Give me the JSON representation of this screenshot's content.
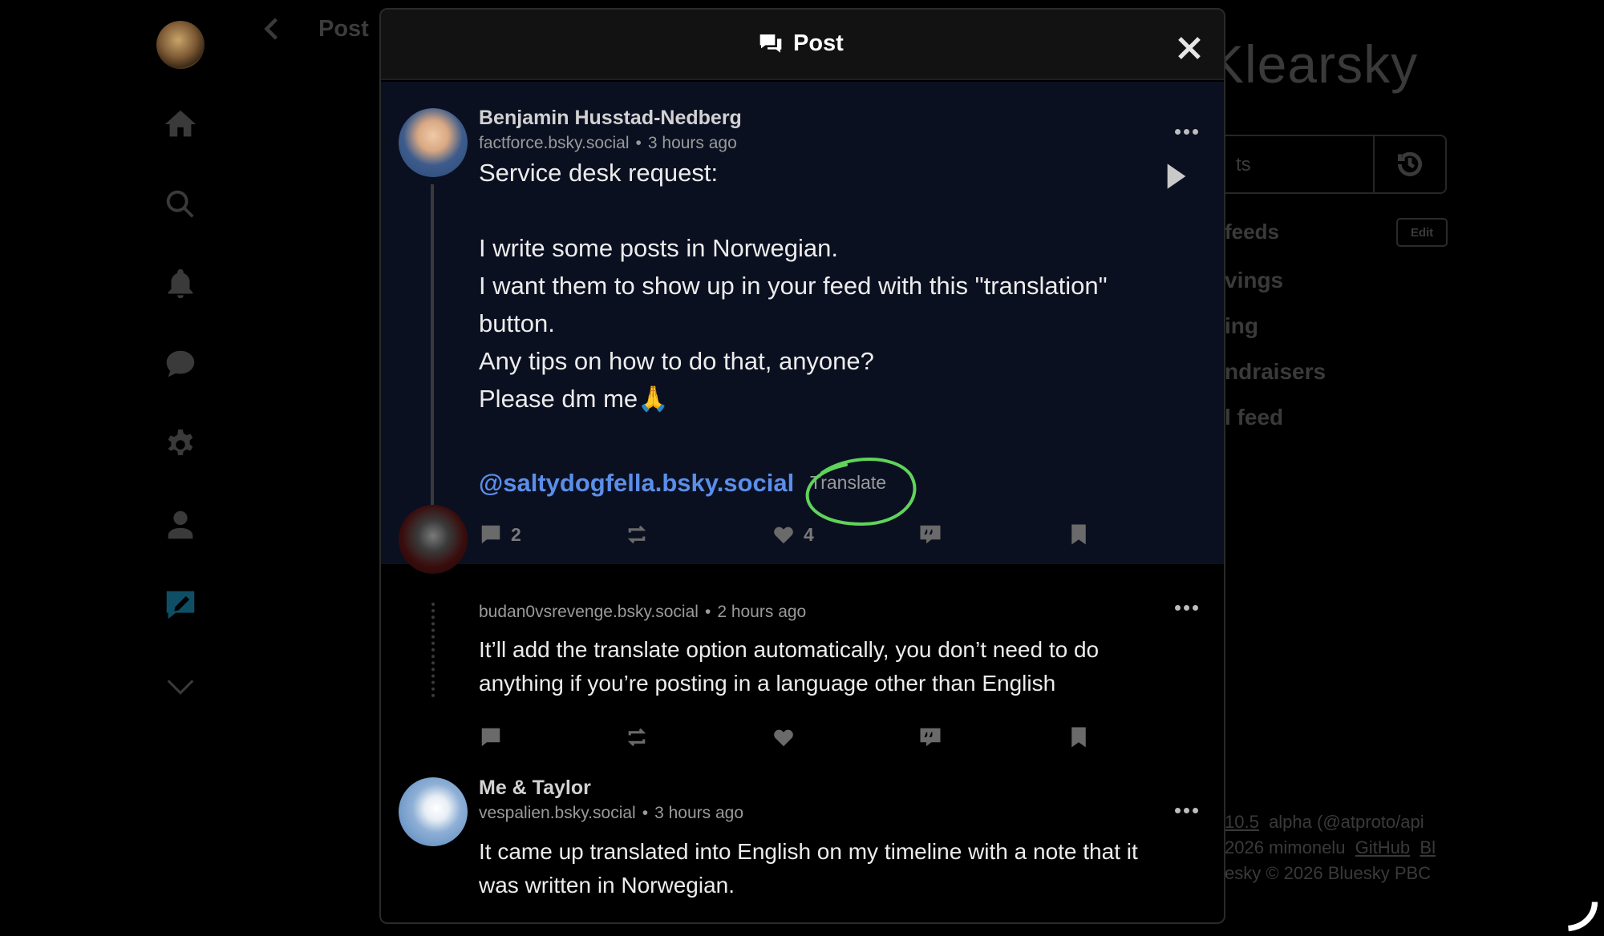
{
  "background": {
    "nav_title": "Post",
    "brand": "Klearsky",
    "search_placeholder": "ts",
    "feeds_label": "feeds",
    "edit_label": "Edit",
    "feeds": [
      "vings",
      "ing",
      "ndraisers",
      "l feed"
    ],
    "footer": {
      "line1_version": "10.5",
      "line1_rest": "alpha (@atproto/api",
      "line2_prefix": "2026 mimonelu",
      "line2_link1": "GitHub",
      "line2_link2": "Bl",
      "line3": "esky © 2026 Bluesky PBC"
    },
    "nav_icons": [
      "home-icon",
      "search-icon",
      "bell-icon",
      "chat-icon",
      "gear-icon",
      "user-icon",
      "compose-icon",
      "chevron-down-icon"
    ]
  },
  "modal": {
    "title": "Post",
    "icon": "chat-bubbles-icon"
  },
  "main_post": {
    "author": "Benjamin Husstad-Nedberg",
    "handle": "factforce.bsky.social",
    "time": "3 hours ago",
    "body": "Service desk request:\n\nI write some posts in Norwegian.\nI want them to show up in your feed with this \"translation\"\nbutton.\nAny tips on how to do that, anyone?\nPlease dm me🙏",
    "mention": "@saltydogfella.bsky.social",
    "translate_label": "Translate",
    "reply_count": "2",
    "repost_count": "",
    "like_count": "4",
    "annotation_color": "#5fd35a"
  },
  "replies": [
    {
      "author": "",
      "handle": "budan0vsrevenge.bsky.social",
      "time": "2 hours ago",
      "body": "It’ll add the translate option automatically, you don’t need to do\nanything if you’re posting in a language other than English"
    },
    {
      "author": "Me & Taylor",
      "handle": "vespalien.bsky.social",
      "time": "3 hours ago",
      "body": "It came up translated into English on my timeline with a note that it\nwas written in Norwegian."
    }
  ],
  "meta_separator": "•"
}
